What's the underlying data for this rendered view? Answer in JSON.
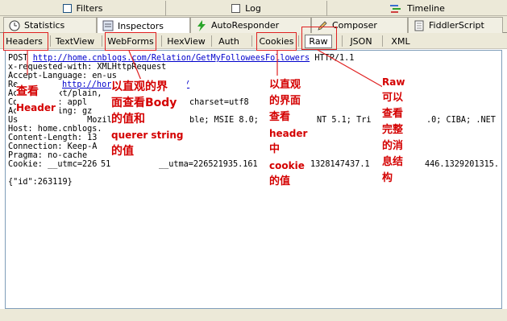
{
  "top_tabs": [
    "Filters",
    "Log",
    "Timeline"
  ],
  "main_tabs": [
    "Statistics",
    "Inspectors",
    "AutoResponder",
    "Composer",
    "FiddlerScript"
  ],
  "sub_tabs": [
    "Headers",
    "TextView",
    "WebForms",
    "HexView",
    "Auth",
    "Cookies",
    "Raw",
    "JSON",
    "XML"
  ],
  "request": {
    "method": "POST",
    "url": "http://home.cnblogs.com/Relation/GetMyFolloweesFollowers",
    "protocol": "HTTP/1.1",
    "headers_visible": [
      "x-requested-with: XMLHttpRequest",
      "Accept-Language: en-us",
      "Re",
      "Ac        xt/plain,",
      "Co      pe: appl",
      "Ac      oding: gz",
      "Us              Mozill",
      "Host: home.cnblogs.",
      "Content-Length: 13",
      "Connection: Keep-A",
      "Pragma: no-cache",
      "Cookie: __utmc=226"
    ],
    "link_partial_1": "http://hor",
    "link_partial_2": "/",
    "fragment_1": "charset=utf8",
    "fragment_2": "ble; MSIE 8.0;",
    "fragment_3": "NT 5.1; Tri",
    "fragment_4": ".0; CIBA; .NET",
    "cookie_mid": "__utma=226521935.161",
    "cookie_mid2": "1328147437.1",
    "cookie_end": "446.1329201315.",
    "cookie_gap": "51",
    "body": "{\"id\":263119}"
  },
  "annotations": {
    "header_note_1": "查看",
    "header_note_2": "Header",
    "webforms_note": [
      "以直观的界",
      "面查看Body",
      "的值和",
      "querer string",
      "的值"
    ],
    "cookies_note": [
      "以直观",
      "的界面",
      "查看",
      "header",
      "中",
      "cookie",
      "的值"
    ],
    "raw_note": [
      "Raw",
      "可以",
      "查看",
      "完整",
      "的消",
      "息结",
      "构"
    ]
  },
  "colors": {
    "annotation": "#e02020",
    "link": "#0000cc"
  }
}
